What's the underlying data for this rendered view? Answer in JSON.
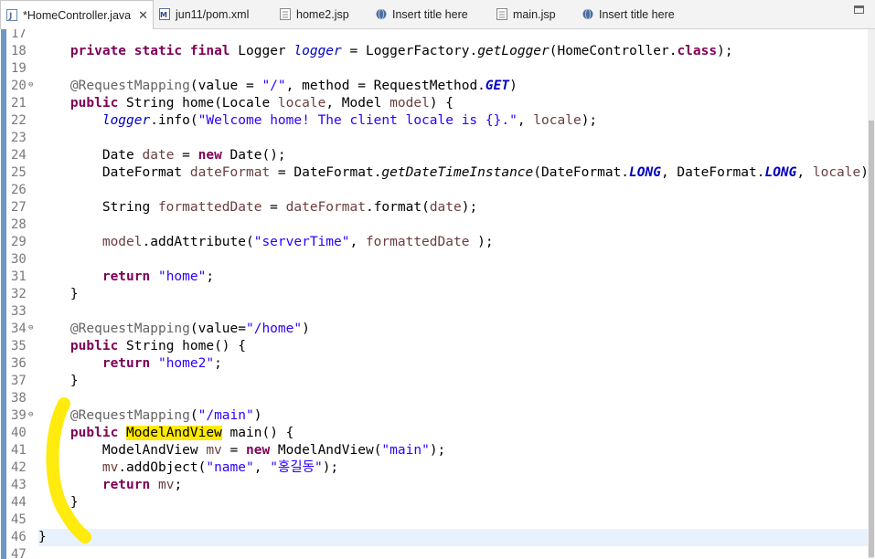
{
  "tabs": [
    {
      "label": "*HomeController.java",
      "icon": "java-file-icon",
      "active": true
    },
    {
      "label": "jun11/pom.xml",
      "icon": "maven-file-icon",
      "active": false
    },
    {
      "label": "home2.jsp",
      "icon": "jsp-file-icon",
      "active": false
    },
    {
      "label": "Insert title here",
      "icon": "globe-icon",
      "active": false
    },
    {
      "label": "main.jsp",
      "icon": "jsp-file-icon",
      "active": false
    },
    {
      "label": "Insert title here",
      "icon": "globe-icon",
      "active": false
    }
  ],
  "close_glyph": "✕",
  "editor": {
    "line_numbers": [
      "17",
      "18",
      "19",
      "20",
      "21",
      "22",
      "23",
      "24",
      "25",
      "26",
      "27",
      "28",
      "29",
      "30",
      "31",
      "32",
      "33",
      "34",
      "35",
      "36",
      "37",
      "38",
      "39",
      "40",
      "41",
      "42",
      "43",
      "44",
      "45",
      "46",
      "47"
    ],
    "fold_glyph": "⊖",
    "current_line": "46",
    "highlighted_word": "ModelAndView",
    "annotation_color": "#ffea00"
  },
  "colors": {
    "keyword": "#7f0055",
    "string": "#2a00ff",
    "annotation": "#646464",
    "field": "#0000c0",
    "local_var": "#6a3e3e",
    "current_line_bg": "#e8f2fe",
    "highlight": "#ffea00"
  }
}
